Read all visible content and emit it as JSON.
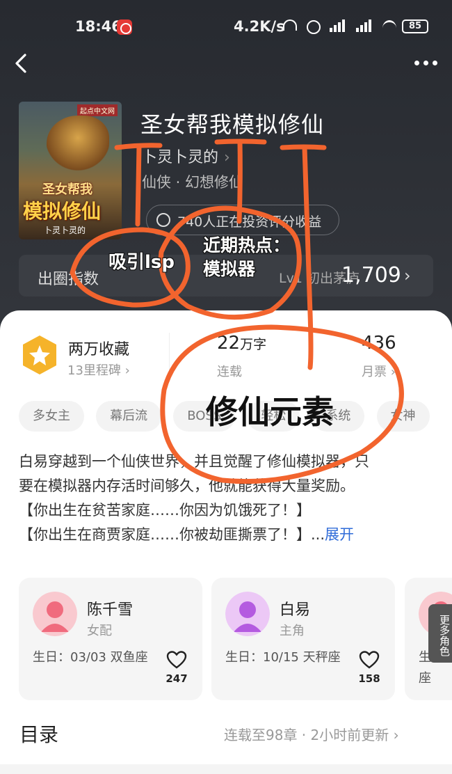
{
  "status_bar": {
    "time": "18:46",
    "net_speed": "4.2K/s",
    "battery": "85",
    "signal_labels": [
      "HD",
      "HD"
    ],
    "wifi_badge": "6"
  },
  "nav": {
    "back_icon": "chevron-left-icon",
    "more_icon": "more-dots-icon"
  },
  "book": {
    "cover_publisher": "起点中文网",
    "cover_line1": "圣女帮我",
    "cover_line2": "模拟修仙",
    "cover_author": "卜灵卜灵的",
    "title": "圣女帮我模拟修仙",
    "author": "卜灵卜灵的",
    "genre": "仙侠 · 幻想修仙",
    "invest": "740人正在投资评分收益"
  },
  "index": {
    "label": "出圈指数",
    "rank": "Lv1 初出茅庐",
    "value": "1,709"
  },
  "stats": {
    "collect_title": "两万收藏",
    "collect_sub": "13里程碑",
    "words_num": "22",
    "words_unit": "万字",
    "words_sub": "连载",
    "monthly_num": "436",
    "monthly_sub": "月票"
  },
  "tags": [
    "多女主",
    "幕后流",
    "BOSS",
    "轻松",
    "系统",
    "女神"
  ],
  "synopsis": {
    "lines": [
      "白易穿越到一个仙侠世界，并且觉醒了修仙模拟器，只",
      "要在模拟器内存活时间够久，他就能获得大量奖励。",
      "【你出生在贫苦家庭……你因为饥饿死了！】",
      "【你出生在商贾家庭……你被劫匪撕票了！】..."
    ],
    "expand": "展开"
  },
  "characters": [
    {
      "name": "陈千雪",
      "role": "女配",
      "birthday": "生日：03/03 双鱼座",
      "likes": "247",
      "color": "#f06b7e"
    },
    {
      "name": "白易",
      "role": "主角",
      "birthday": "生日：10/15 天秤座",
      "likes": "158",
      "color": "#b45be0"
    },
    {
      "name": "",
      "role": "",
      "birthday": "生日：座",
      "likes": "",
      "color": "#f06b7e"
    }
  ],
  "more_roles": "更多角色",
  "toc": {
    "title": "目录",
    "status": "连载至98章 · 2小时前更新"
  },
  "annotations": {
    "a1": "吸引lsp",
    "a2_line1": "近期热点：",
    "a2_line2": "模拟器",
    "a3": "修仙元素"
  },
  "colors": {
    "annotation": "#f2642e",
    "link": "#2f6bd8",
    "badge": "#f5b32a"
  }
}
